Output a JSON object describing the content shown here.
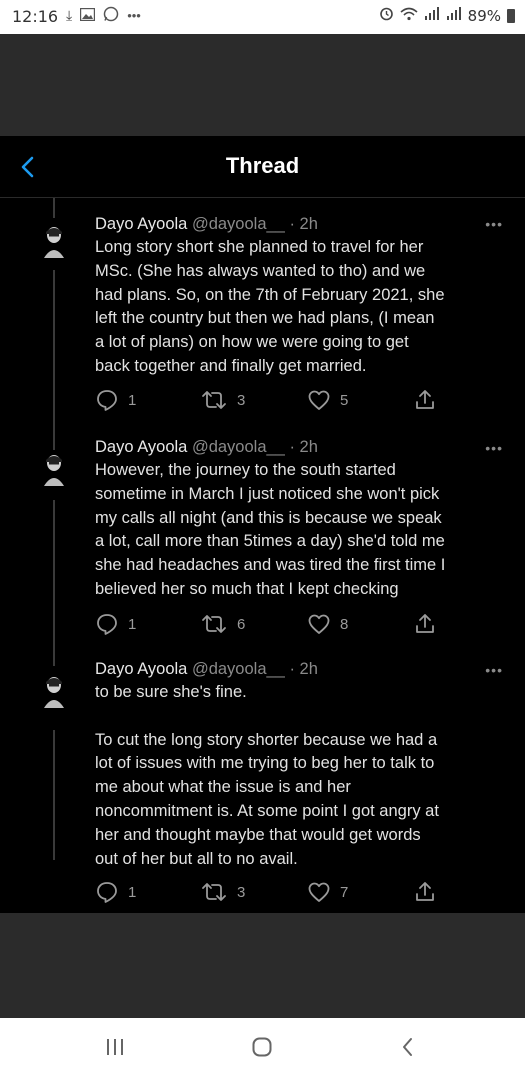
{
  "status_bar": {
    "time": "12:16",
    "battery": "89%",
    "left_icons": [
      "download-icon",
      "gallery-icon",
      "whatsapp-icon",
      "more-dots"
    ],
    "right_icons": [
      "alarm-icon",
      "wifi-icon",
      "signal-icon",
      "signal-icon",
      "battery-icon"
    ]
  },
  "header": {
    "title": "Thread"
  },
  "tweets": [
    {
      "name": "Dayo Ayoola",
      "handle": "@dayoola__",
      "time": "· 2h",
      "text": "Long story short she planned to travel for her\nMSc. (She has always wanted to tho) and we\nhad plans. So, on the 7th of February 2021, she\nleft the country but then we had plans, (I mean\na lot of plans) on how we were going to get\nback together and finally get married.",
      "replies": "1",
      "retweets": "3",
      "likes": "5"
    },
    {
      "name": "Dayo Ayoola",
      "handle": "@dayoola__",
      "time": "· 2h",
      "text": "However, the journey to the south started\nsometime in March I just noticed she won't pick\nmy calls all night (and this is because we speak\na lot, call more than 5times a day) she'd told me\nshe had headaches and was tired the first time I\nbelieved her so much that I kept checking",
      "replies": "1",
      "retweets": "6",
      "likes": "8"
    },
    {
      "name": "Dayo Ayoola",
      "handle": "@dayoola__",
      "time": "· 2h",
      "text": "to be sure she's fine.\n\nTo cut the long story shorter because we had a\nlot of issues with me trying to beg her to talk to\nme about what the issue is and her\nnoncommitment is. At some point I got angry at\nher and thought maybe that would get words\nout of her but all to no avail.",
      "replies": "1",
      "retweets": "3",
      "likes": "7"
    }
  ],
  "colors": {
    "accent": "#1d9bf0",
    "background": "#000000",
    "text": "#e2e2e2",
    "muted": "#8a8a8a"
  }
}
